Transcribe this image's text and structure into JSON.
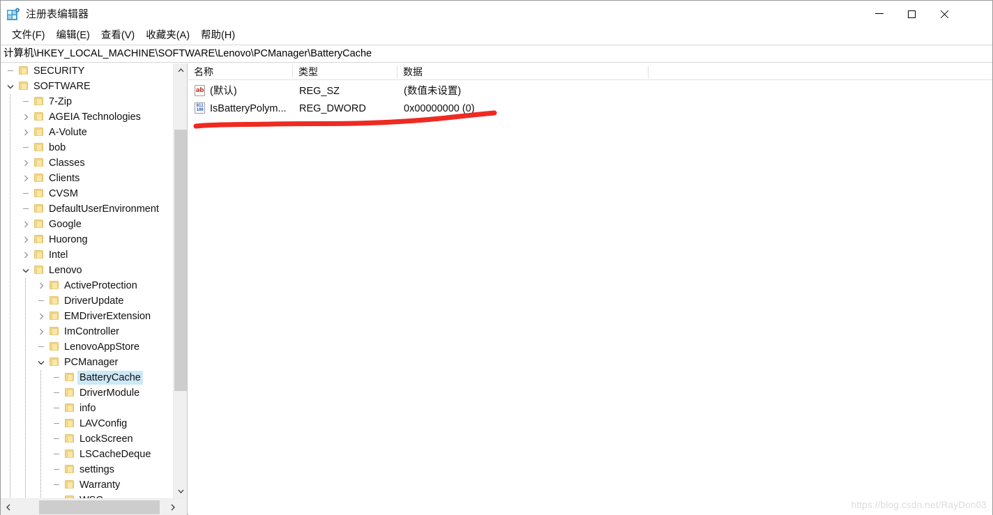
{
  "window": {
    "title": "注册表编辑器",
    "icon": "registry-editor-icon",
    "minimize_label": "—",
    "maximize_label": "□",
    "close_label": "✕"
  },
  "menubar": {
    "items": [
      {
        "label": "文件(F)",
        "name": "menu-file"
      },
      {
        "label": "编辑(E)",
        "name": "menu-edit"
      },
      {
        "label": "查看(V)",
        "name": "menu-view"
      },
      {
        "label": "收藏夹(A)",
        "name": "menu-favorites"
      },
      {
        "label": "帮助(H)",
        "name": "menu-help"
      }
    ]
  },
  "address": {
    "path": "计算机\\HKEY_LOCAL_MACHINE\\SOFTWARE\\Lenovo\\PCManager\\BatteryCache"
  },
  "tree": {
    "nodes": [
      {
        "label": "SECURITY",
        "depth": 1,
        "expander": "none",
        "selected": false
      },
      {
        "label": "SOFTWARE",
        "depth": 1,
        "expander": "expanded",
        "selected": false
      },
      {
        "label": "7-Zip",
        "depth": 2,
        "expander": "none",
        "selected": false
      },
      {
        "label": "AGEIA Technologies",
        "depth": 2,
        "expander": "collapsed",
        "selected": false
      },
      {
        "label": "A-Volute",
        "depth": 2,
        "expander": "collapsed",
        "selected": false
      },
      {
        "label": "bob",
        "depth": 2,
        "expander": "none",
        "selected": false
      },
      {
        "label": "Classes",
        "depth": 2,
        "expander": "collapsed",
        "selected": false
      },
      {
        "label": "Clients",
        "depth": 2,
        "expander": "collapsed",
        "selected": false
      },
      {
        "label": "CVSM",
        "depth": 2,
        "expander": "none",
        "selected": false
      },
      {
        "label": "DefaultUserEnvironment",
        "depth": 2,
        "expander": "none",
        "selected": false
      },
      {
        "label": "Google",
        "depth": 2,
        "expander": "collapsed",
        "selected": false
      },
      {
        "label": "Huorong",
        "depth": 2,
        "expander": "collapsed",
        "selected": false
      },
      {
        "label": "Intel",
        "depth": 2,
        "expander": "collapsed",
        "selected": false
      },
      {
        "label": "Lenovo",
        "depth": 2,
        "expander": "expanded",
        "selected": false
      },
      {
        "label": "ActiveProtection",
        "depth": 3,
        "expander": "collapsed",
        "selected": false
      },
      {
        "label": "DriverUpdate",
        "depth": 3,
        "expander": "none",
        "selected": false
      },
      {
        "label": "EMDriverExtension",
        "depth": 3,
        "expander": "collapsed",
        "selected": false
      },
      {
        "label": "ImController",
        "depth": 3,
        "expander": "collapsed",
        "selected": false
      },
      {
        "label": "LenovoAppStore",
        "depth": 3,
        "expander": "none",
        "selected": false
      },
      {
        "label": "PCManager",
        "depth": 3,
        "expander": "expanded",
        "selected": false
      },
      {
        "label": "BatteryCache",
        "depth": 4,
        "expander": "none",
        "selected": true
      },
      {
        "label": "DriverModule",
        "depth": 4,
        "expander": "none",
        "selected": false
      },
      {
        "label": "info",
        "depth": 4,
        "expander": "none",
        "selected": false
      },
      {
        "label": "LAVConfig",
        "depth": 4,
        "expander": "none",
        "selected": false
      },
      {
        "label": "LockScreen",
        "depth": 4,
        "expander": "none",
        "selected": false
      },
      {
        "label": "LSCacheDeque",
        "depth": 4,
        "expander": "none",
        "selected": false
      },
      {
        "label": "settings",
        "depth": 4,
        "expander": "none",
        "selected": false
      },
      {
        "label": "Warranty",
        "depth": 4,
        "expander": "none",
        "selected": false
      },
      {
        "label": "WSC",
        "depth": 4,
        "expander": "none",
        "selected": false
      }
    ]
  },
  "list": {
    "columns": [
      {
        "label": "名称",
        "name": "column-name"
      },
      {
        "label": "类型",
        "name": "column-type"
      },
      {
        "label": "数据",
        "name": "column-data"
      }
    ],
    "rows": [
      {
        "icon": "string-value-icon",
        "name": "(默认)",
        "type": "REG_SZ",
        "data": "(数值未设置)"
      },
      {
        "icon": "dword-value-icon",
        "name": "IsBatteryPolym...",
        "type": "REG_DWORD",
        "data": "0x00000000 (0)"
      }
    ]
  },
  "annotation": {
    "name": "red-underline-annotation",
    "color": "#ee2a22"
  },
  "scrollbars": {
    "tree_up": "⌃",
    "tree_down": "⌄",
    "tree_left": "‹",
    "tree_right": "›"
  },
  "watermark": {
    "text": "https://blog.csdn.net/RayDon03"
  },
  "colors": {
    "selection": "#cde8f7",
    "folder": "#f2d98c",
    "annotation": "#ee2a22",
    "watermark": "#dcdcdc"
  }
}
